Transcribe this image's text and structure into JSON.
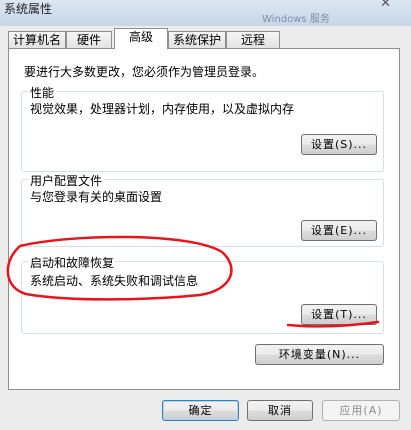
{
  "window": {
    "title": "系统属性",
    "background_title": "Windows 服务"
  },
  "tabs": [
    {
      "label": "计算机名"
    },
    {
      "label": "硬件"
    },
    {
      "label": "高级",
      "active": true
    },
    {
      "label": "系统保护"
    },
    {
      "label": "远程"
    }
  ],
  "intro": "要进行大多数更改，您必须作为管理员登录。",
  "groups": {
    "performance": {
      "title": "性能",
      "desc": "视觉效果，处理器计划，内存使用，以及虚拟内存",
      "button": "设置(S)..."
    },
    "user_profiles": {
      "title": "用户配置文件",
      "desc": "与您登录有关的桌面设置",
      "button": "设置(E)..."
    },
    "startup_recovery": {
      "title": "启动和故障恢复",
      "desc": "系统启动、系统失败和调试信息",
      "button": "设置(T)..."
    }
  },
  "env_button": "环境变量(N)...",
  "footer": {
    "ok": "确定",
    "cancel": "取消",
    "apply": "应用(A)"
  },
  "colors": {
    "annotation_red": "#e8141b",
    "accent_blue": "#3c7fb1"
  }
}
